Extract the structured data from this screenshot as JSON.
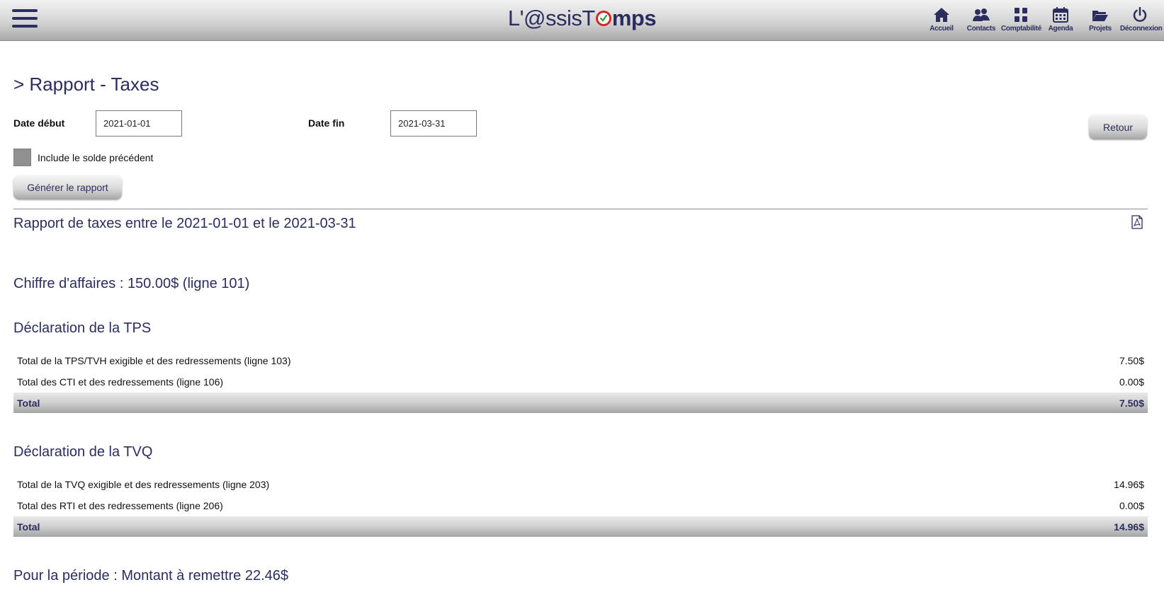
{
  "header": {
    "logo_prefix": "L'@ssisT",
    "logo_suffix": "mps",
    "nav": [
      {
        "label": "Accueil",
        "icon": "home-icon"
      },
      {
        "label": "Contacts",
        "icon": "contacts-icon"
      },
      {
        "label": "Comptabilité",
        "icon": "grid-icon"
      },
      {
        "label": "Agenda",
        "icon": "calendar-icon"
      },
      {
        "label": "Projets",
        "icon": "folder-icon"
      },
      {
        "label": "Déconnexion",
        "icon": "power-icon"
      }
    ]
  },
  "page": {
    "title": "> Rapport - Taxes"
  },
  "filters": {
    "start_label": "Date début",
    "start_value": "2021-01-01",
    "end_label": "Date fin",
    "end_value": "2021-03-31",
    "include_previous_label": "Include le solde précédent",
    "include_previous_checked": false,
    "generate_label": "Générer le rapport",
    "back_label": "Retour"
  },
  "report": {
    "title": "Rapport de taxes entre le 2021-01-01 et le 2021-03-31",
    "revenue": "Chiffre d'affaires : 150.00$ (ligne 101)",
    "tps": {
      "heading": "Déclaration de la TPS",
      "rows": [
        {
          "label": "Total de la TPS/TVH exigible et des redressements (ligne 103)",
          "amount": "7.50$"
        },
        {
          "label": "Total des CTI et des redressements (ligne 106)",
          "amount": "0.00$"
        }
      ],
      "total_label": "Total",
      "total_amount": "7.50$"
    },
    "tvq": {
      "heading": "Déclaration de la TVQ",
      "rows": [
        {
          "label": "Total de la TVQ exigible et des redressements (ligne 203)",
          "amount": "14.96$"
        },
        {
          "label": "Total des RTI et des redressements (ligne 206)",
          "amount": "0.00$"
        }
      ],
      "total_label": "Total",
      "total_amount": "14.96$"
    },
    "remit": "Pour la période : Montant à remettre 22.46$"
  },
  "colors": {
    "brand": "#2b2d5e",
    "logo_accent": "#cf2a2a"
  }
}
